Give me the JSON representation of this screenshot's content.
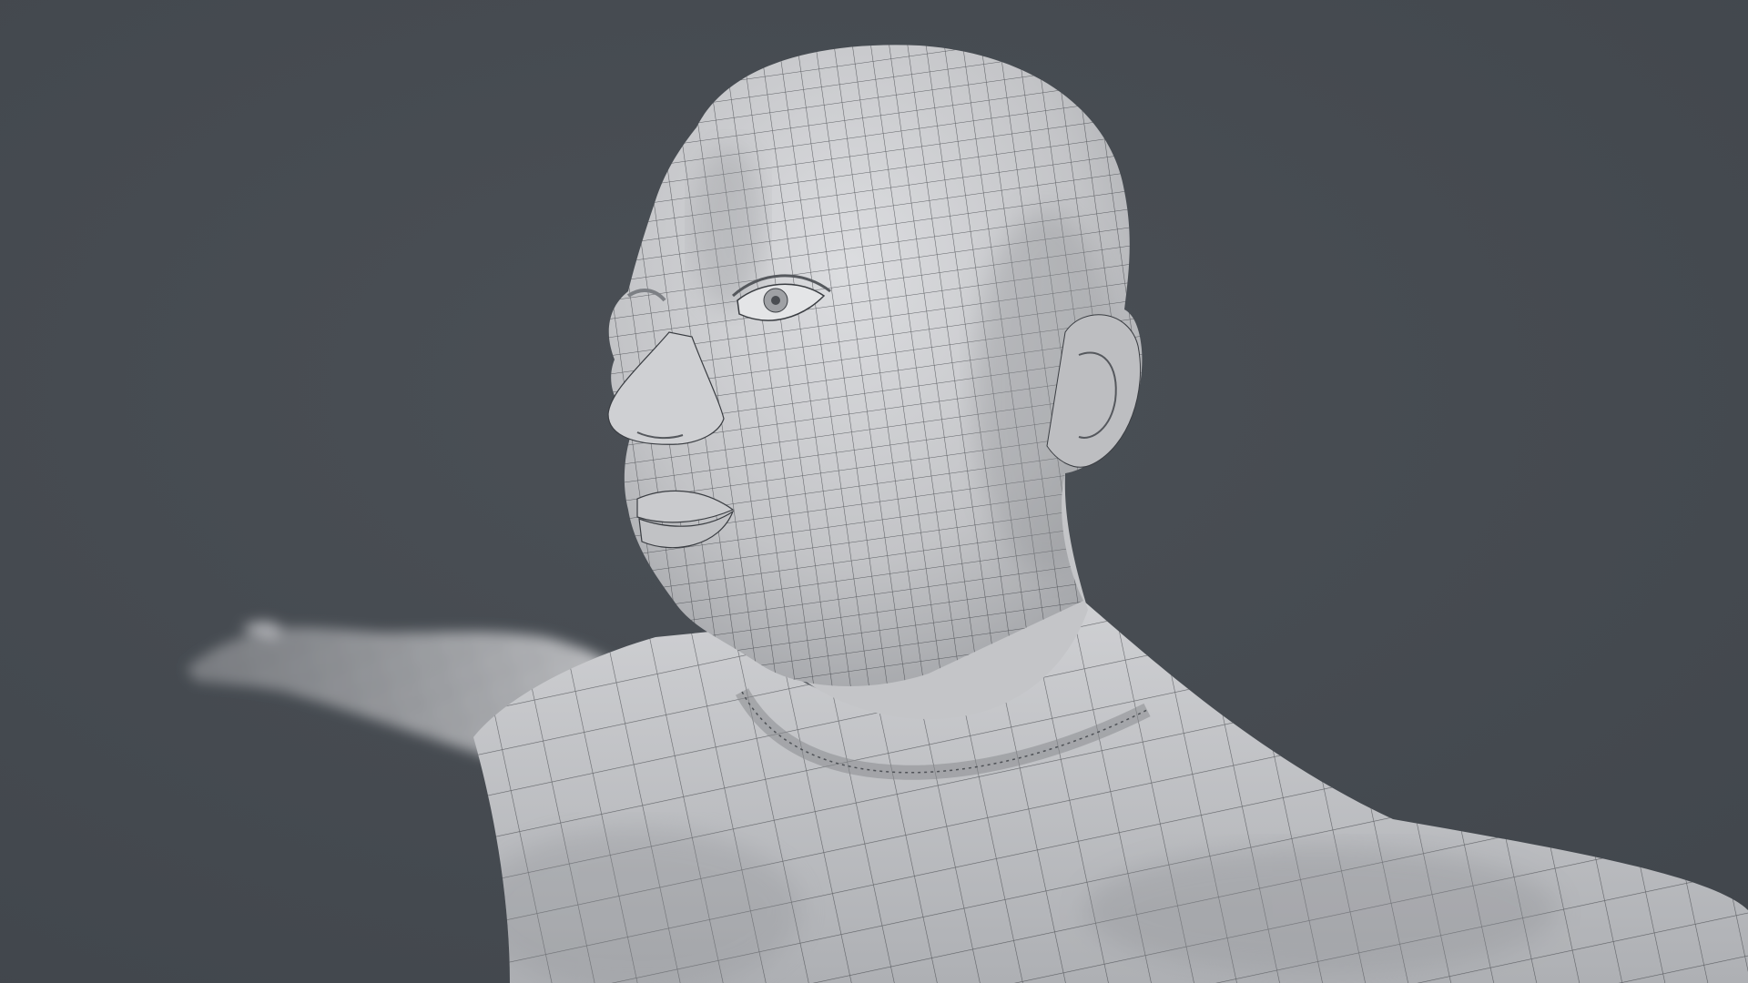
{
  "scene": {
    "subject": "wireframe-render",
    "background_color": "#464b51",
    "surface_color": "#c8c9cb",
    "wire_color": "#3a3d42"
  }
}
